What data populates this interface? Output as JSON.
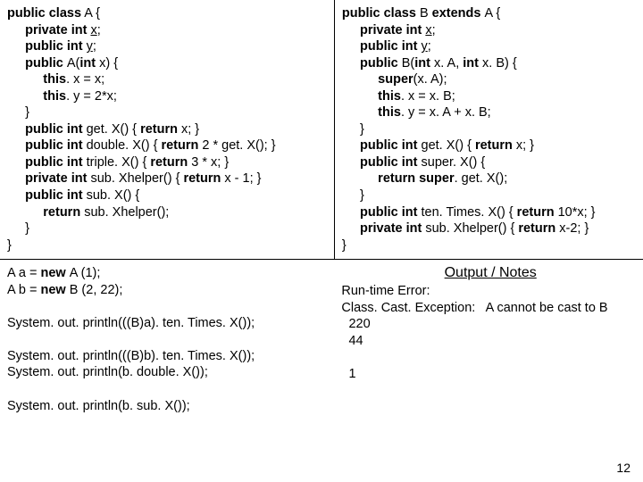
{
  "classA": {
    "l1": "public class",
    "l1b": " A {",
    "l2": "     private int ",
    "l2b": "x",
    "l2c": ";",
    "l3": "     public int ",
    "l3b": "y",
    "l3c": ";",
    "l4": "     public ",
    "l4b": "A(",
    "l4c": "int ",
    "l4d": "x) {",
    "l5": "          this",
    "l5b": ". x = x;",
    "l6": "          this",
    "l6b": ". y = 2*x;",
    "l7": "     }",
    "l8": "     public int ",
    "l8b": "get. X() { ",
    "l8c": "return ",
    "l8d": "x; }",
    "l9": "     public int ",
    "l9b": "double. X() { ",
    "l9c": "return ",
    "l9d": "2 * get. X(); }",
    "l10": "     public int ",
    "l10b": "triple. X() { ",
    "l10c": "return ",
    "l10d": "3 * x; }",
    "l11": "     private int ",
    "l11b": "sub. Xhelper() { ",
    "l11c": "return ",
    "l11d": "x - 1; }",
    "l12": "     public int ",
    "l12b": "sub. X() {",
    "l13": "          return ",
    "l13b": "sub. Xhelper();",
    "l14": "     }",
    "l15": "}"
  },
  "classB": {
    "l1": "public class ",
    "l1b": "B ",
    "l1c": "extends ",
    "l1d": "A {",
    "l2": "     private int ",
    "l2b": "x",
    "l2c": ";",
    "l3": "     public int ",
    "l3b": "y",
    "l3c": ";",
    "l4": "     public ",
    "l4b": "B(",
    "l4c": "int ",
    "l4d": "x. A, ",
    "l4e": "int ",
    "l4f": "x. B) {",
    "l5": "          super",
    "l5b": "(x. A);",
    "l6": "          this",
    "l6b": ". x = x. B;",
    "l7": "          this",
    "l7b": ". y = x. A + x. B;",
    "l8": "     }",
    "l9": "     public int ",
    "l9b": "get. X() { ",
    "l9c": "return ",
    "l9d": "x; }",
    "l10": "     public int ",
    "l10b": "super. X() {",
    "l11": "          return super",
    "l11b": ". get. X();",
    "l12": "     }",
    "l13": "     public int ",
    "l13b": "ten. Times. X() { ",
    "l13c": "return ",
    "l13d": "10*x; }",
    "l14": "     private int ",
    "l14b": "sub. Xhelper() { ",
    "l14c": "return ",
    "l14d": "x-2; }",
    "l15": "}"
  },
  "calls": {
    "l1a": "A a = ",
    "l1b": "new ",
    "l1c": "A (1);",
    "l2a": "A b = ",
    "l2b": "new ",
    "l2c": "B (2, 22);",
    "gap": " ",
    "l3": "System. out. println(((B)a). ten. Times. X());",
    "g2": " ",
    "l4": "System. out. println(((B)b). ten. Times. X());",
    "l5": "System. out. println(b. double. X());",
    "g3": " ",
    "l6": "System. out. println(b. sub. X());"
  },
  "output": {
    "heading": "Output / Notes",
    "l1": "Run-time Error:",
    "l2": "Class. Cast. Exception:   A cannot be cast to B",
    "l3": "  220",
    "l4": "  44",
    "g": " ",
    "l5": "  1"
  },
  "pagenum": "12"
}
